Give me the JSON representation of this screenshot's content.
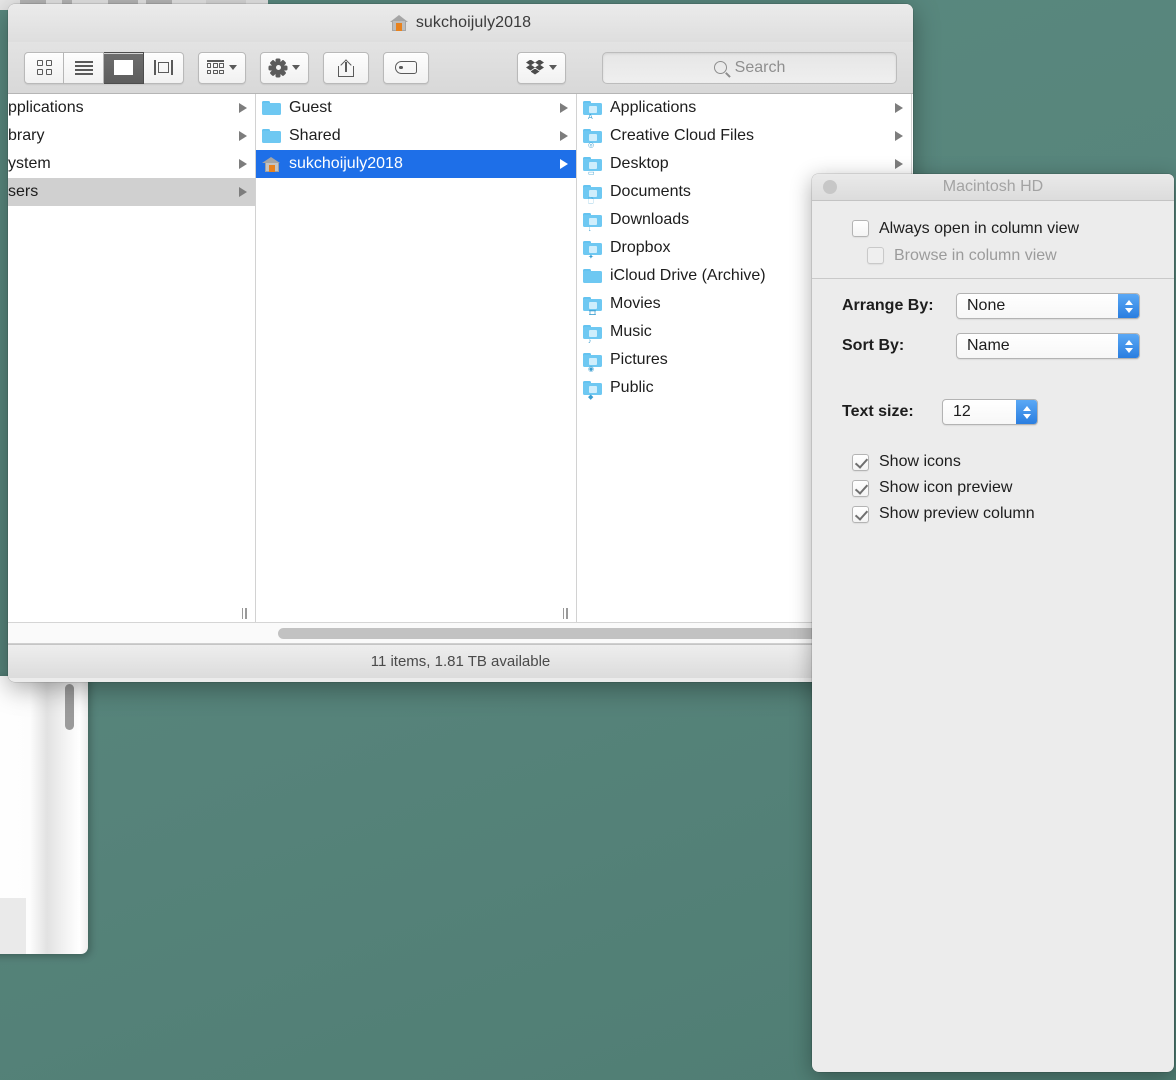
{
  "desktop": {
    "background_color": "#58867c"
  },
  "finder": {
    "title": "sukchoijuly2018",
    "title_icon": "home-icon",
    "toolbar": {
      "view_modes": [
        {
          "name": "icon-view",
          "icon": "grid-icon",
          "active": false
        },
        {
          "name": "list-view",
          "icon": "list-icon",
          "active": false
        },
        {
          "name": "column-view",
          "icon": "column-icon",
          "active": true
        },
        {
          "name": "gallery-view",
          "icon": "coverflow-icon",
          "active": false
        }
      ],
      "arrange_icon": "arrange-icon",
      "action_icon": "gear-icon",
      "share_icon": "share-icon",
      "tag_icon": "tag-icon",
      "dropbox_icon": "dropbox-icon",
      "search_placeholder": "Search",
      "search_value": ""
    },
    "columns": [
      {
        "name": "column-1",
        "clipped": true,
        "items": [
          {
            "label": "pplications",
            "full_label": "Applications",
            "has_arrow": true,
            "icon": "none",
            "selected": false
          },
          {
            "label": "brary",
            "full_label": "Library",
            "has_arrow": true,
            "icon": "none",
            "selected": false
          },
          {
            "label": "ystem",
            "full_label": "System",
            "has_arrow": true,
            "icon": "none",
            "selected": false
          },
          {
            "label": "sers",
            "full_label": "Users",
            "has_arrow": true,
            "icon": "none",
            "selected": "gray"
          }
        ]
      },
      {
        "name": "column-2",
        "clipped": false,
        "items": [
          {
            "label": "Guest",
            "has_arrow": true,
            "icon": "folder-plain",
            "selected": false
          },
          {
            "label": "Shared",
            "has_arrow": true,
            "icon": "folder-plain",
            "selected": false
          },
          {
            "label": "sukchoijuly2018",
            "has_arrow": true,
            "icon": "home-folder",
            "selected": "blue"
          }
        ]
      },
      {
        "name": "column-3",
        "clipped": false,
        "items": [
          {
            "label": "Applications",
            "has_arrow": true,
            "icon": "folder-applications",
            "selected": false
          },
          {
            "label": "Creative Cloud Files",
            "has_arrow": true,
            "icon": "folder-creativecloud",
            "selected": false
          },
          {
            "label": "Desktop",
            "has_arrow": true,
            "icon": "folder-desktop",
            "selected": false
          },
          {
            "label": "Documents",
            "has_arrow": false,
            "icon": "folder-documents",
            "selected": false
          },
          {
            "label": "Downloads",
            "has_arrow": false,
            "icon": "folder-downloads",
            "selected": false
          },
          {
            "label": "Dropbox",
            "has_arrow": false,
            "icon": "folder-dropbox",
            "selected": false
          },
          {
            "label": "iCloud Drive (Archive)",
            "has_arrow": false,
            "icon": "folder-plain",
            "selected": false
          },
          {
            "label": "Movies",
            "has_arrow": false,
            "icon": "folder-movies",
            "selected": false
          },
          {
            "label": "Music",
            "has_arrow": false,
            "icon": "folder-music",
            "selected": false
          },
          {
            "label": "Pictures",
            "has_arrow": false,
            "icon": "folder-pictures",
            "selected": false
          },
          {
            "label": "Public",
            "has_arrow": false,
            "icon": "folder-public",
            "selected": false
          }
        ]
      }
    ],
    "status": "11 items, 1.81 TB available"
  },
  "view_options": {
    "title": "Macintosh HD",
    "always_open_column": {
      "label": "Always open in column view",
      "checked": false,
      "enabled": true
    },
    "browse_column": {
      "label": "Browse in column view",
      "checked": false,
      "enabled": false
    },
    "arrange_by": {
      "label": "Arrange By:",
      "value": "None"
    },
    "sort_by": {
      "label": "Sort By:",
      "value": "Name"
    },
    "text_size": {
      "label": "Text size:",
      "value": "12"
    },
    "show_icons": {
      "label": "Show icons",
      "checked": true
    },
    "show_icon_preview": {
      "label": "Show icon preview",
      "checked": true
    },
    "show_preview_column": {
      "label": "Show preview column",
      "checked": true
    }
  }
}
